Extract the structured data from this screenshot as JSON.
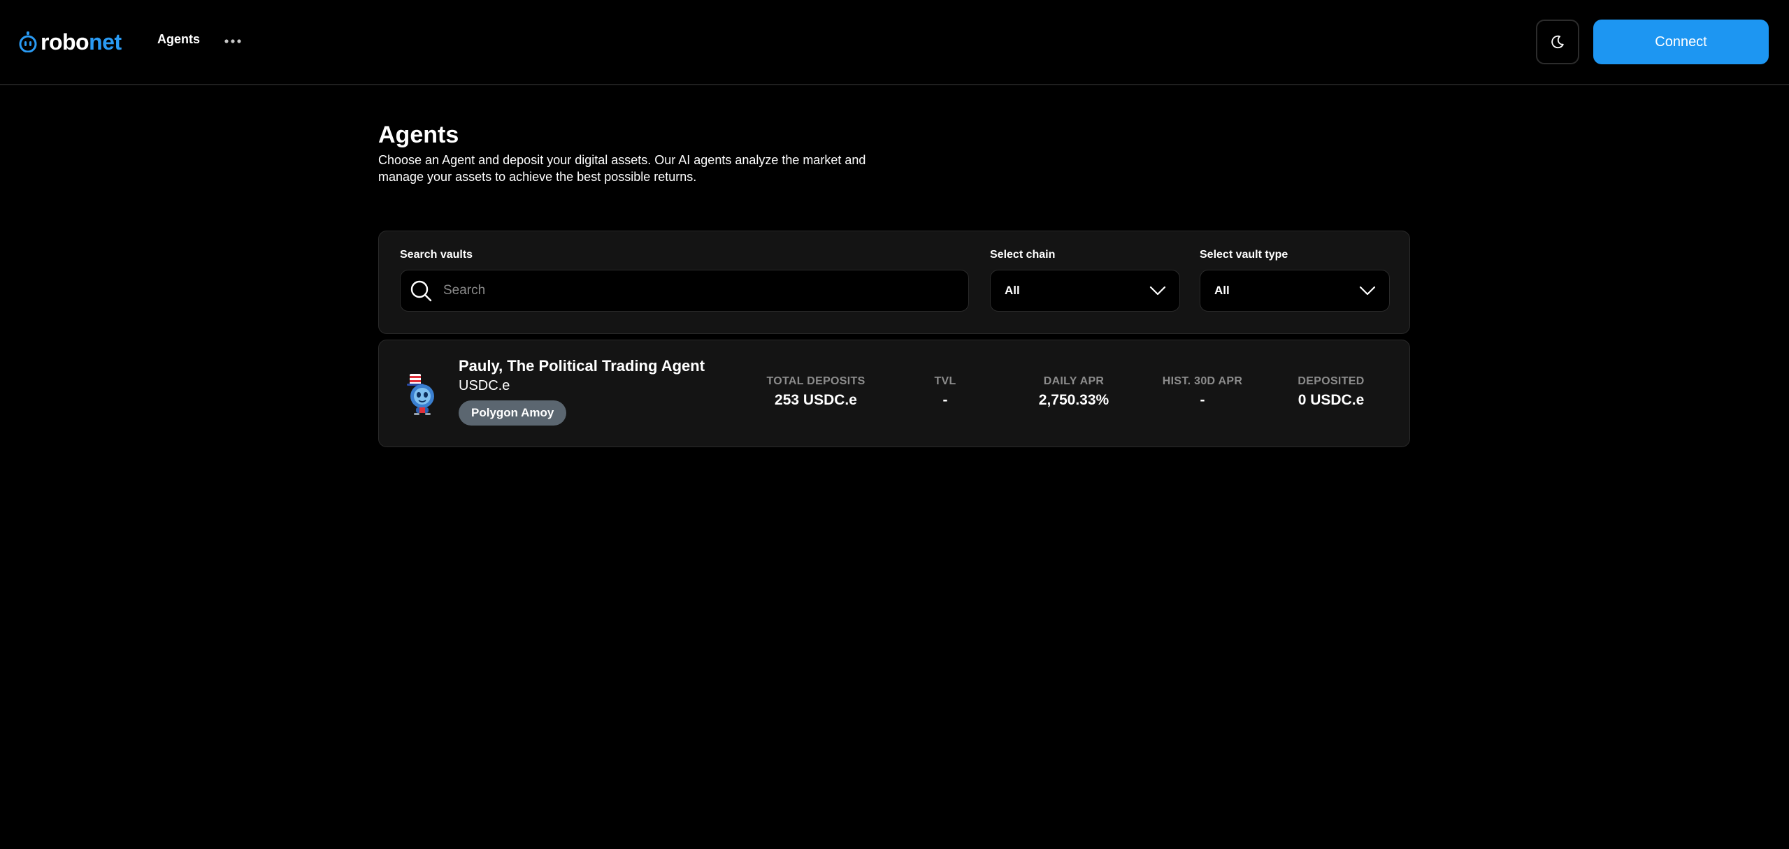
{
  "brand": {
    "name_part1": "robo",
    "name_part2": "net",
    "accent_color": "#2a9bf4"
  },
  "nav": {
    "items": [
      {
        "label": "Agents"
      }
    ],
    "more_icon": "ellipsis-icon"
  },
  "header_actions": {
    "theme_icon": "moon-icon",
    "connect_label": "Connect",
    "connect_color": "#1d96f2"
  },
  "page": {
    "title": "Agents",
    "description": "Choose an Agent and deposit your digital assets. Our AI agents analyze the market and manage your assets to achieve the best possible returns."
  },
  "filters": {
    "search_label": "Search vaults",
    "search_placeholder": "Search",
    "search_value": "",
    "chain_label": "Select chain",
    "chain_value": "All",
    "vault_type_label": "Select vault type",
    "vault_type_value": "All"
  },
  "vaults": [
    {
      "name": "Pauly, The Political Trading Agent",
      "asset": "USDC.e",
      "chain": "Polygon Amoy",
      "avatar_icon": "robot-uncle-sam-icon",
      "stats": [
        {
          "label": "TOTAL DEPOSITS",
          "value": "253 USDC.e"
        },
        {
          "label": "TVL",
          "value": "-"
        },
        {
          "label": "DAILY APR",
          "value": "2,750.33%"
        },
        {
          "label": "HIST. 30D APR",
          "value": "-"
        },
        {
          "label": "DEPOSITED",
          "value": "0 USDC.e"
        }
      ]
    }
  ]
}
